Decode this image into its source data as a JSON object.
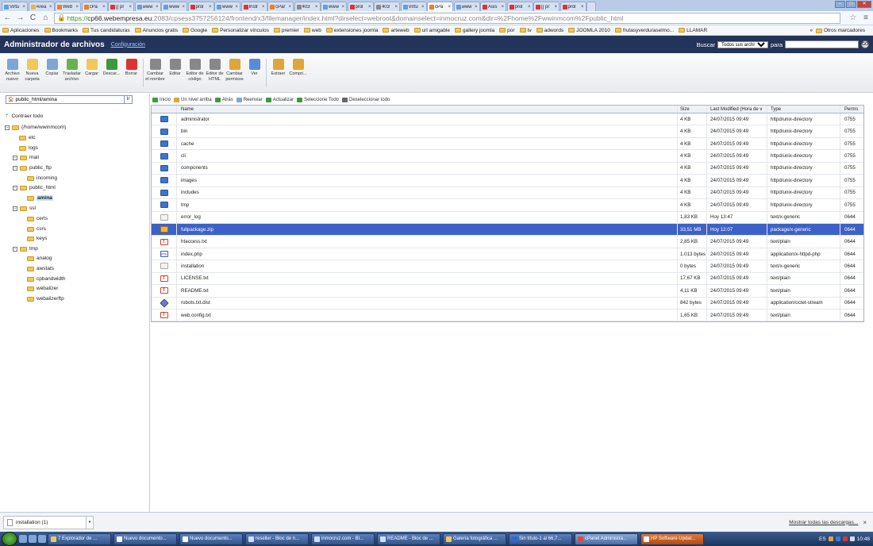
{
  "tabs": [
    {
      "label": "Virtu",
      "color": "#5aa2d8"
    },
    {
      "label": "Área",
      "color": "#f0b43c"
    },
    {
      "label": "Web",
      "color": "#f07d1f"
    },
    {
      "label": "cPa",
      "color": "#f07d1f"
    },
    {
      "label": "[] pr",
      "color": "#d33"
    },
    {
      "label": "www",
      "color": "#6a9ad8"
    },
    {
      "label": "www",
      "color": "#6a9ad8"
    },
    {
      "label": "prol",
      "color": "#d33"
    },
    {
      "label": "www",
      "color": "#6a9ad8"
    },
    {
      "label": "Instr",
      "color": "#d33"
    },
    {
      "label": "cPar",
      "color": "#f07d1f"
    },
    {
      "label": "403",
      "color": "#888"
    },
    {
      "label": "www",
      "color": "#6a9ad8"
    },
    {
      "label": "prol",
      "color": "#d33"
    },
    {
      "label": "403",
      "color": "#888"
    },
    {
      "label": "Virtu",
      "color": "#5aa2d8"
    },
    {
      "label": "cPa",
      "color": "#f07d1f",
      "active": true
    },
    {
      "label": "www",
      "color": "#6a9ad8"
    },
    {
      "label": "Asis",
      "color": "#d33"
    },
    {
      "label": "prol",
      "color": "#d33"
    },
    {
      "label": "[] pr",
      "color": "#d33"
    },
    {
      "label": "prol",
      "color": "#d33"
    }
  ],
  "url": {
    "scheme": "https://",
    "host": "cp66.webempresa.eu",
    "rest": ":2083/cpsess3757256124/frontend/x3/filemanager/index.html?dirselect=webroot&domainselect=inmocruz.com&dir=%2Fhome%2Fwwinmcom%2Fpublic_html"
  },
  "bookmarks": [
    "Aplicaciones",
    "Bookmarks",
    "Tus candidaturas",
    "Anuncios gratis",
    "Google",
    "Personalizar vínculos",
    "premier",
    "web",
    "extensiones joomla",
    "arteweb",
    "url amigable",
    "gallery joomla",
    "por",
    "tv",
    "adwords",
    "JOOMLA 2010",
    "frutasyverduraselmo...",
    "LLAMAR"
  ],
  "bookmarks_other": "Otros marcadores",
  "cpanel": {
    "title": "Administrador de archivos",
    "config": "Configuración",
    "search_label": "Buscar",
    "search_scope": "Todos sus archivos",
    "para": "para",
    "go": "GO"
  },
  "toolbar": [
    {
      "label": "Archivo nuevo",
      "color": "#7aa6d8"
    },
    {
      "label": "Nueva carpeta",
      "color": "#f1c85a"
    },
    {
      "label": "Copiar",
      "color": "#7aa6d8"
    },
    {
      "label": "Trasladar archivo",
      "color": "#68b34f"
    },
    {
      "label": "Cargar",
      "color": "#f1c85a"
    },
    {
      "label": "Descar...",
      "color": "#3c9a3c"
    },
    {
      "label": "Borrar",
      "color": "#d33"
    },
    {
      "label": "Cambiar el nombre",
      "color": "#888"
    },
    {
      "label": "Editar",
      "color": "#888"
    },
    {
      "label": "Editor de código",
      "color": "#888"
    },
    {
      "label": "Editor de HTML",
      "color": "#888"
    },
    {
      "label": "Cambiar permisos",
      "color": "#e0a53a"
    },
    {
      "label": "Ver",
      "color": "#5a8ad8"
    },
    {
      "label": "Extraer",
      "color": "#e0a53a"
    },
    {
      "label": "Compri...",
      "color": "#e0a53a"
    }
  ],
  "path": "public_html/amina",
  "path_go": "Ir",
  "actions": [
    {
      "label": "Inicio",
      "color": "#3c9a3c"
    },
    {
      "label": "Un nivel arriba",
      "color": "#e0a53a"
    },
    {
      "label": "Atrás",
      "color": "#3c9a3c"
    },
    {
      "label": "Reenviar",
      "color": "#7aa6d8"
    },
    {
      "label": "Actualizar",
      "color": "#3c9a3c"
    },
    {
      "label": "Seleccione Todo",
      "color": "#3c9a3c"
    },
    {
      "label": "Deseleccionar todo",
      "color": "#666"
    }
  ],
  "tree": {
    "collapse": "Contraer todo",
    "items": [
      {
        "label": "(/home/wwinmcom)"
      },
      {
        "label": "etc"
      },
      {
        "label": "logs"
      },
      {
        "label": "mail"
      },
      {
        "label": "public_ftp"
      },
      {
        "label": "incoming"
      },
      {
        "label": "public_html"
      },
      {
        "label": "amina",
        "selected": true
      },
      {
        "label": "ssl"
      },
      {
        "label": "certs"
      },
      {
        "label": "csrs"
      },
      {
        "label": "keys"
      },
      {
        "label": "tmp"
      },
      {
        "label": "analog"
      },
      {
        "label": "awstats"
      },
      {
        "label": "cpbandwidth"
      },
      {
        "label": "webalizer"
      },
      {
        "label": "webalizerftp"
      }
    ]
  },
  "table": {
    "headers": [
      "Name",
      "Size",
      "Last Modified (Hora de v",
      "Type",
      "Perms"
    ],
    "rows": [
      {
        "icon": "folder",
        "name": "administrator",
        "size": "4 KB",
        "modified": "24/07/2015 09:49",
        "type": "httpd/unix-directory",
        "perms": "0755"
      },
      {
        "icon": "folder",
        "name": "bin",
        "size": "4 KB",
        "modified": "24/07/2015 09:49",
        "type": "httpd/unix-directory",
        "perms": "0755"
      },
      {
        "icon": "folder",
        "name": "cache",
        "size": "4 KB",
        "modified": "24/07/2015 09:49",
        "type": "httpd/unix-directory",
        "perms": "0755"
      },
      {
        "icon": "folder",
        "name": "cli",
        "size": "4 KB",
        "modified": "24/07/2015 09:49",
        "type": "httpd/unix-directory",
        "perms": "0755"
      },
      {
        "icon": "folder",
        "name": "components",
        "size": "4 KB",
        "modified": "24/07/2015 09:49",
        "type": "httpd/unix-directory",
        "perms": "0755"
      },
      {
        "icon": "folder",
        "name": "images",
        "size": "4 KB",
        "modified": "24/07/2015 09:49",
        "type": "httpd/unix-directory",
        "perms": "0755"
      },
      {
        "icon": "folder",
        "name": "includes",
        "size": "4 KB",
        "modified": "24/07/2015 09:49",
        "type": "httpd/unix-directory",
        "perms": "0755"
      },
      {
        "icon": "folder",
        "name": "tmp",
        "size": "4 KB",
        "modified": "24/07/2015 09:49",
        "type": "httpd/unix-directory",
        "perms": "0755"
      },
      {
        "icon": "generic",
        "name": "error_log",
        "size": "1,83 KB",
        "modified": "Hoy 13:47",
        "type": "text/x-generic",
        "perms": "0644"
      },
      {
        "icon": "zip",
        "name": "fullpackage.zip",
        "size": "33,51 MB",
        "modified": "Hoy 12:07",
        "type": "package/x-generic",
        "perms": "0644",
        "selected": true
      },
      {
        "icon": "text",
        "name": "htaccess.txt",
        "size": "2,85 KB",
        "modified": "24/07/2015 09:49",
        "type": "text/plain",
        "perms": "0644"
      },
      {
        "icon": "php",
        "name": "index.php",
        "size": "1.013 bytes",
        "modified": "24/07/2015 09:49",
        "type": "application/x-httpd-php",
        "perms": "0644"
      },
      {
        "icon": "generic",
        "name": "installation",
        "size": "0 bytes",
        "modified": "24/07/2015 09:49",
        "type": "text/x-generic",
        "perms": "0644"
      },
      {
        "icon": "text",
        "name": "LICENSE.txt",
        "size": "17,67 KB",
        "modified": "24/07/2015 09:49",
        "type": "text/plain",
        "perms": "0644"
      },
      {
        "icon": "text",
        "name": "README.txt",
        "size": "4,11 KB",
        "modified": "24/07/2015 09:49",
        "type": "text/plain",
        "perms": "0644"
      },
      {
        "icon": "diamond",
        "name": "robots.txt.dist",
        "size": "842 bytes",
        "modified": "24/07/2015 09:49",
        "type": "application/octet-stream",
        "perms": "0644"
      },
      {
        "icon": "text",
        "name": "web.config.txt",
        "size": "1,65 KB",
        "modified": "24/07/2015 09:49",
        "type": "text/plain",
        "perms": "0644"
      }
    ]
  },
  "downloads": {
    "item": "installation (1)",
    "show_all": "Mostrar todas las descargas...",
    "close": "×"
  },
  "taskbar": {
    "items": [
      {
        "label": "7 Explorador de ...",
        "color": "#f1c85a"
      },
      {
        "label": "Nuevo documento...",
        "color": "#fff"
      },
      {
        "label": "Nuevo documento...",
        "color": "#fff"
      },
      {
        "label": "reseller - Bloc de n...",
        "color": "#cfe0f5"
      },
      {
        "label": "inmocruz.com - Bl...",
        "color": "#cfe0f5"
      },
      {
        "label": "README - Bloc de ...",
        "color": "#cfe0f5"
      },
      {
        "label": "Galería fotográfica ...",
        "color": "#f1c85a"
      },
      {
        "label": "Sin título-1 al 66,7...",
        "color": "#2a6ad8"
      },
      {
        "label": "cPanel Administra...",
        "color": "#e04a3a",
        "active": true
      },
      {
        "label": "HP Software Updat...",
        "color": "#fff",
        "hp": true
      }
    ],
    "lang": "ES",
    "time": "10:48"
  }
}
